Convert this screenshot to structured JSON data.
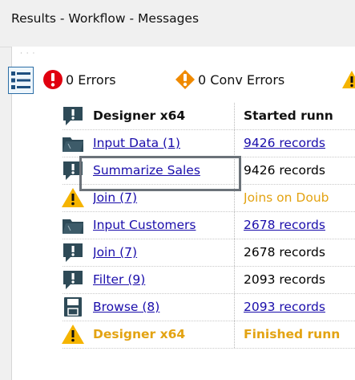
{
  "window": {
    "title": "Results - Workflow - Messages"
  },
  "toolbar": {
    "errors_label": "0 Errors",
    "conv_errors_label": "0 Conv Errors",
    "colors": {
      "error": "#e0000f",
      "conv_error": "#f08a00",
      "warning": "#f5b400"
    }
  },
  "columns": {
    "tool": "Designer x64",
    "message": "Started runn"
  },
  "rows": [
    {
      "tool": "Input Data (1)",
      "message": "9426 records",
      "icon": "input-data-icon",
      "tool_style": "link",
      "msg_style": "link"
    },
    {
      "tool": "Summarize Sales",
      "message": "9426 records",
      "icon": "info-message-icon",
      "tool_style": "link",
      "msg_style": "plain"
    },
    {
      "tool": "Join (7)",
      "message": "Joins on Doub",
      "icon": "warning-icon",
      "tool_style": "link",
      "msg_style": "warn"
    },
    {
      "tool": "Input Customers",
      "message": "2678 records",
      "icon": "input-data-icon",
      "tool_style": "link",
      "msg_style": "link"
    },
    {
      "tool": "Join (7)",
      "message": "2678 records",
      "icon": "info-message-icon",
      "tool_style": "link",
      "msg_style": "plain"
    },
    {
      "tool": "Filter (9)",
      "message": "2093 records",
      "icon": "info-message-icon",
      "tool_style": "link",
      "msg_style": "plain"
    },
    {
      "tool": "Browse (8)",
      "message": "2093 records",
      "icon": "save-icon",
      "tool_style": "link",
      "msg_style": "link"
    },
    {
      "tool": "Designer x64",
      "message": "Finished runn",
      "icon": "warning-icon",
      "tool_style": "warn-bold",
      "msg_style": "warn-bold"
    }
  ]
}
